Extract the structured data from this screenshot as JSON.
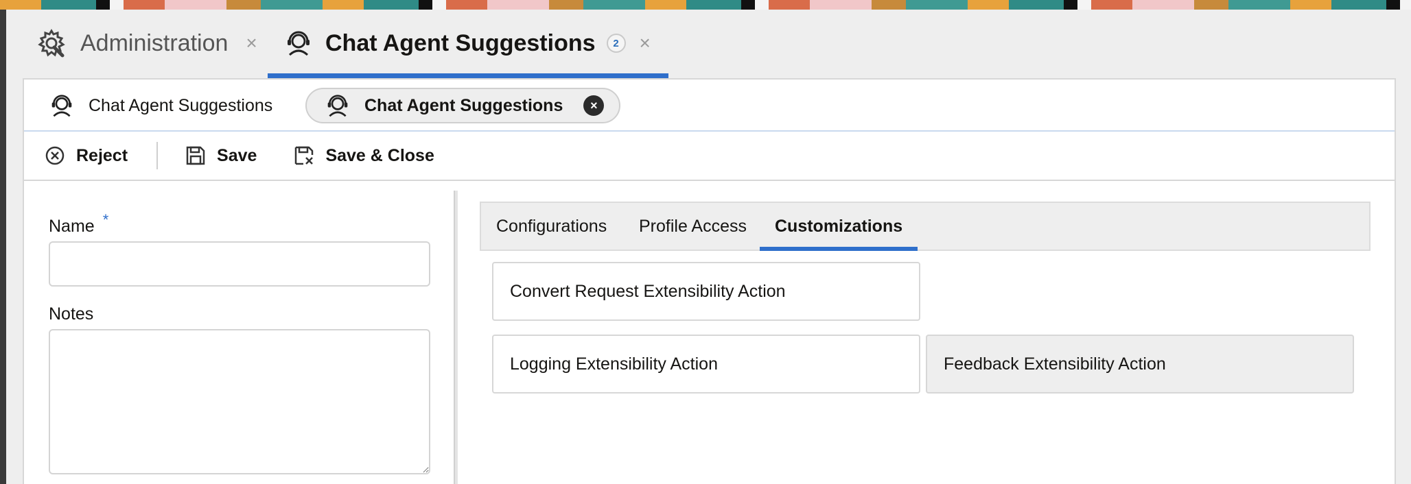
{
  "top_tabs": [
    {
      "label": "Administration",
      "icon": "gear-icon",
      "close": "×"
    },
    {
      "label": "Chat Agent Suggestions",
      "icon": "agent-icon",
      "badge": "2",
      "close": "×"
    }
  ],
  "sub_tabs": [
    {
      "label": "Chat Agent Suggestions",
      "icon": "agent-icon"
    },
    {
      "label": "Chat Agent Suggestions",
      "icon": "agent-icon",
      "close": "×"
    }
  ],
  "toolbar": {
    "reject_label": "Reject",
    "save_label": "Save",
    "save_close_label": "Save & Close"
  },
  "form": {
    "name_label": "Name",
    "required_marker": "*",
    "name_value": "",
    "notes_label": "Notes",
    "notes_value": ""
  },
  "detail_tabs": [
    {
      "label": "Configurations"
    },
    {
      "label": "Profile Access"
    },
    {
      "label": "Customizations"
    }
  ],
  "cards": [
    {
      "label": "Convert Request Extensibility Action"
    },
    {
      "label": "Logging Extensibility Action"
    },
    {
      "label": "Feedback Extensibility Action"
    }
  ],
  "colors": {
    "accent": "#2f6fcb",
    "text": "#161513",
    "panel_bg": "#eeeeee"
  }
}
